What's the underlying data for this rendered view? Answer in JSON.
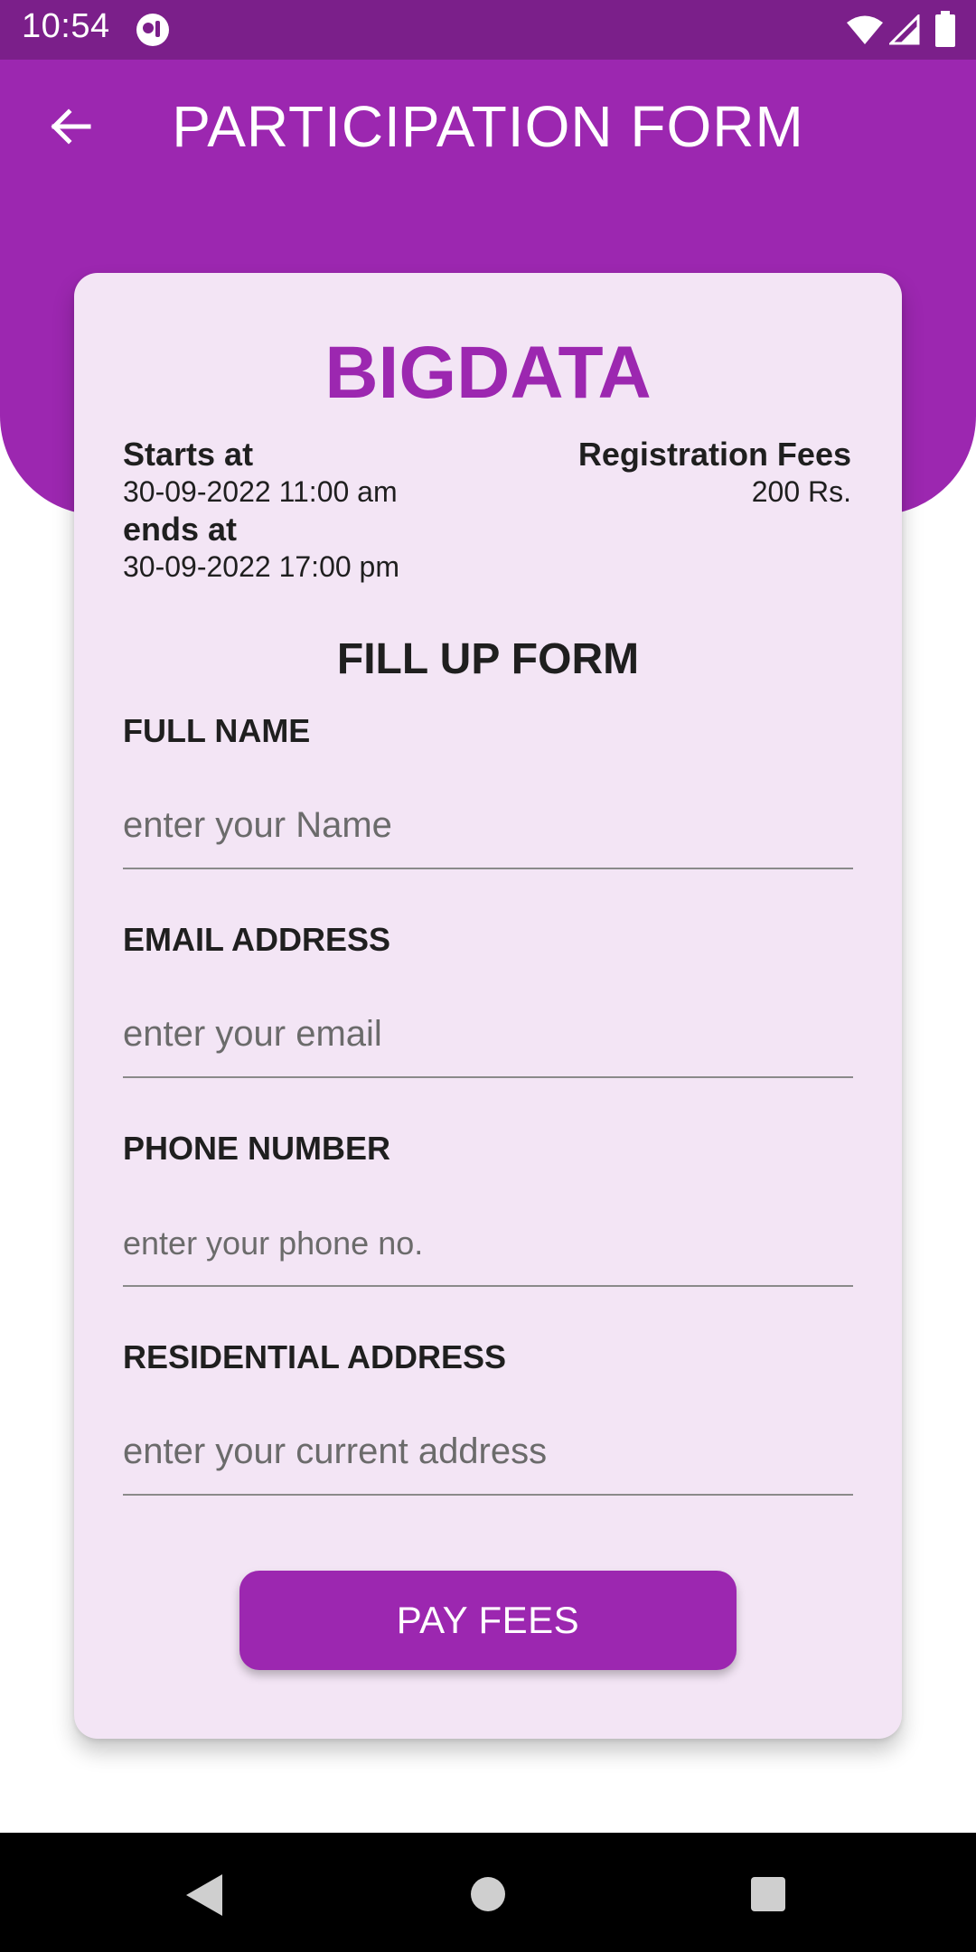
{
  "status_bar": {
    "time": "10:54",
    "icons": [
      "app-notification-icon",
      "wifi-icon",
      "signal-icon",
      "battery-icon"
    ]
  },
  "app_bar": {
    "title": "PARTICIPATION FORM",
    "back_icon": "arrow-back-icon",
    "color": "#9c27b0"
  },
  "event": {
    "name": "BIGDATA",
    "starts_label": "Starts at",
    "starts_value": "30-09-2022 11:00 am",
    "ends_label": "ends at",
    "ends_value": "30-09-2022 17:00 pm",
    "fees_label": "Registration Fees",
    "fees_value": "200 Rs."
  },
  "form": {
    "heading": "FILL UP FORM",
    "fields": [
      {
        "label": "FULL NAME",
        "placeholder": "enter your Name",
        "value": ""
      },
      {
        "label": "EMAIL ADDRESS",
        "placeholder": "enter your email",
        "value": ""
      },
      {
        "label": "PHONE NUMBER",
        "placeholder": "enter your phone no.",
        "value": ""
      },
      {
        "label": "RESIDENTIAL ADDRESS",
        "placeholder": "enter your current address",
        "value": ""
      }
    ],
    "submit_label": "PAY FEES"
  },
  "colors": {
    "primary": "#9c27b0",
    "status_bar": "#7b1f8a",
    "card_background": "#f3e5f5"
  },
  "nav_bar": {
    "icons": [
      "nav-back-icon",
      "nav-home-icon",
      "nav-recents-icon"
    ]
  }
}
